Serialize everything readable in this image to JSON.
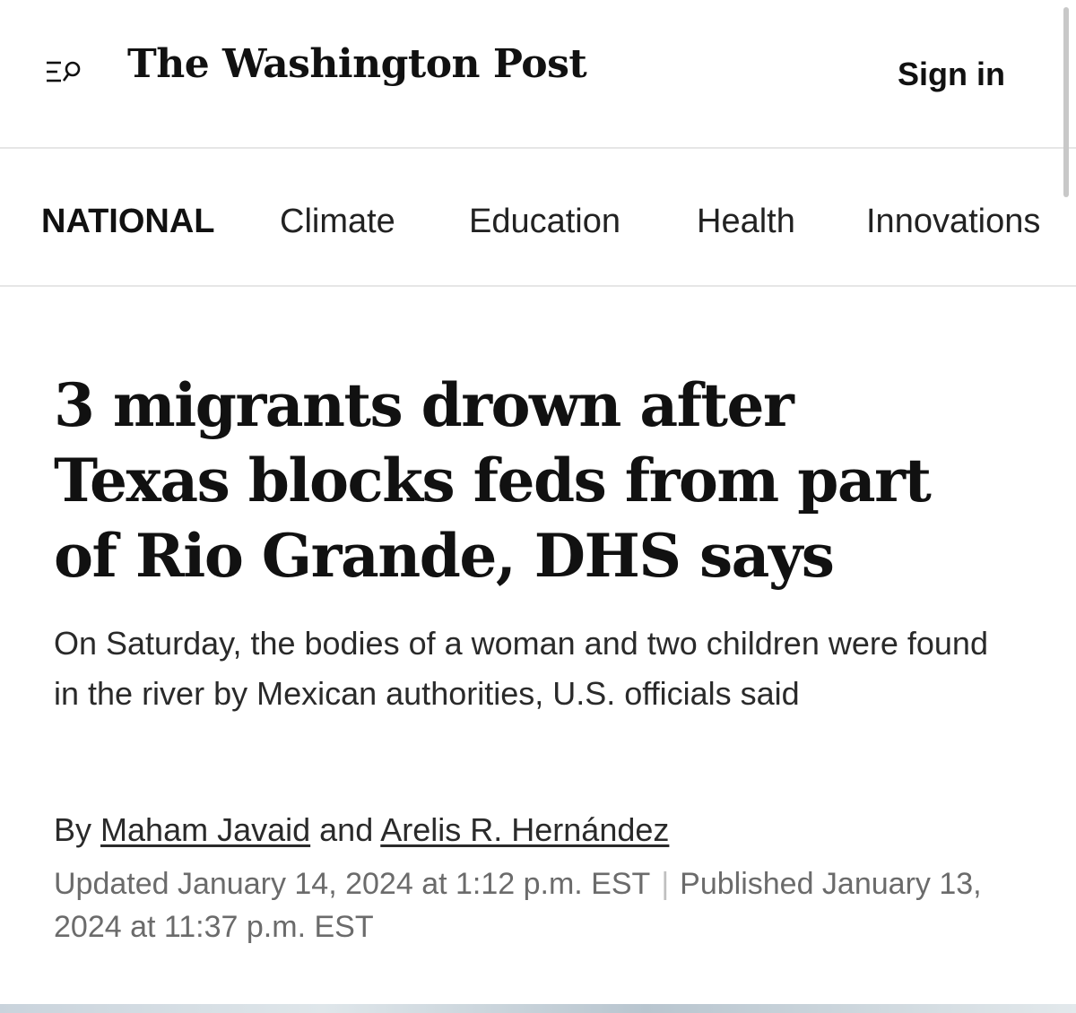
{
  "header": {
    "logo_text": "The Washington Post",
    "sign_in": "Sign in",
    "menu_icon": "menu-search-icon"
  },
  "section_nav": {
    "items": [
      "NATIONAL",
      "Climate",
      "Education",
      "Health",
      "Innovations"
    ],
    "active": "NATIONAL"
  },
  "article": {
    "headline": "3 migrants drown after Texas blocks feds from part of Rio Grande, DHS says",
    "dek": "On Saturday, the bodies of a woman and two children were found in the river by Mexican authorities, U.S. officials said",
    "byline": {
      "prefix": "By",
      "author1": "Maham Javaid",
      "joiner": "and",
      "author2": "Arelis R. Hernández"
    },
    "updated": "Updated January 14, 2024 at 1:12 p.m. EST",
    "separator": "|",
    "published": "Published January 13, 2024 at 11:37 p.m. EST"
  }
}
